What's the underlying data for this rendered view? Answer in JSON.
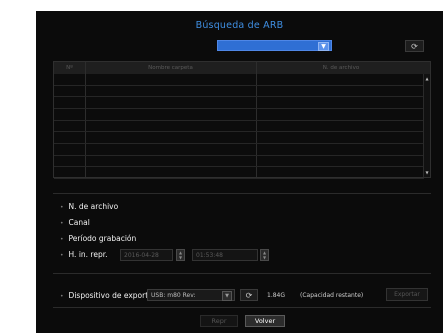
{
  "dialog": {
    "title": "Búsqueda de ARB",
    "folder_select": {
      "value": ""
    },
    "refresh_icon": "refresh-icon"
  },
  "table": {
    "columns": [
      "Nº",
      "Nombre carpeta",
      "N. de archivo"
    ],
    "rows": [
      [
        "",
        "",
        ""
      ],
      [
        "",
        "",
        ""
      ],
      [
        "",
        "",
        ""
      ],
      [
        "",
        "",
        ""
      ],
      [
        "",
        "",
        ""
      ],
      [
        "",
        "",
        ""
      ],
      [
        "",
        "",
        ""
      ],
      [
        "",
        "",
        ""
      ],
      [
        "",
        "",
        ""
      ]
    ]
  },
  "criteria": {
    "file_number": "N. de archivo",
    "channel": "Canal",
    "recording_period": "Período grabación",
    "play_time": {
      "label": "H. in. repr.",
      "date": "2016-04-28",
      "time": "01:53:48"
    }
  },
  "export": {
    "label": "Dispositivo de exporta",
    "device": "USB: m80 Rev:",
    "capacity_value": "1.84G",
    "capacity_label": "(Capacidad restante)",
    "export_button": "Exportar"
  },
  "footer": {
    "play_button": "Repr",
    "back_button": "Volver"
  },
  "colors": {
    "accent": "#3f8fe3",
    "select_blue": "#2f6fd4",
    "panel": "#0b0b0b"
  }
}
